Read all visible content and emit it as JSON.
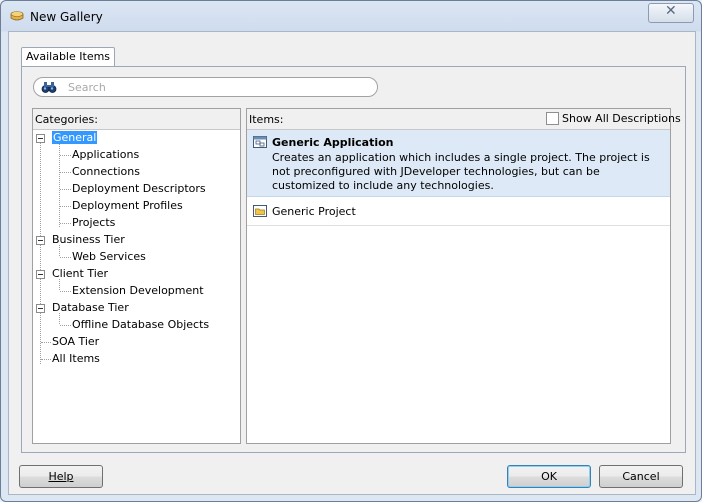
{
  "window": {
    "title": "New Gallery",
    "close_glyph": "✕"
  },
  "tab": {
    "label": "Available Items"
  },
  "search": {
    "placeholder": "Search",
    "value": "",
    "icon": "binoculars-icon"
  },
  "categories": {
    "header": "Categories:",
    "tree": [
      {
        "label": "General",
        "level": 0,
        "expanded": true,
        "selected": true
      },
      {
        "label": "Applications",
        "level": 1
      },
      {
        "label": "Connections",
        "level": 1
      },
      {
        "label": "Deployment Descriptors",
        "level": 1
      },
      {
        "label": "Deployment Profiles",
        "level": 1
      },
      {
        "label": "Projects",
        "level": 1
      },
      {
        "label": "Business Tier",
        "level": 0,
        "expanded": true
      },
      {
        "label": "Web Services",
        "level": 1
      },
      {
        "label": "Client Tier",
        "level": 0,
        "expanded": true
      },
      {
        "label": "Extension Development",
        "level": 1
      },
      {
        "label": "Database Tier",
        "level": 0,
        "expanded": true
      },
      {
        "label": "Offline Database Objects",
        "level": 1
      },
      {
        "label": "SOA Tier",
        "level": 0
      },
      {
        "label": "All Items",
        "level": 0
      }
    ]
  },
  "items": {
    "header": "Items:",
    "show_all_label": "Show All Descriptions",
    "show_all_checked": false,
    "list": [
      {
        "title": "Generic Application",
        "description": "Creates an application which includes a single project. The project is not preconfigured with JDeveloper technologies, but can be customized to include any technologies.",
        "selected": true
      },
      {
        "title": "Generic Project",
        "description": "",
        "selected": false
      }
    ]
  },
  "buttons": {
    "help": "Help",
    "ok": "OK",
    "cancel": "Cancel"
  },
  "colors": {
    "selection": "#3399ff",
    "selected_item_bg": "#dde9f6"
  }
}
